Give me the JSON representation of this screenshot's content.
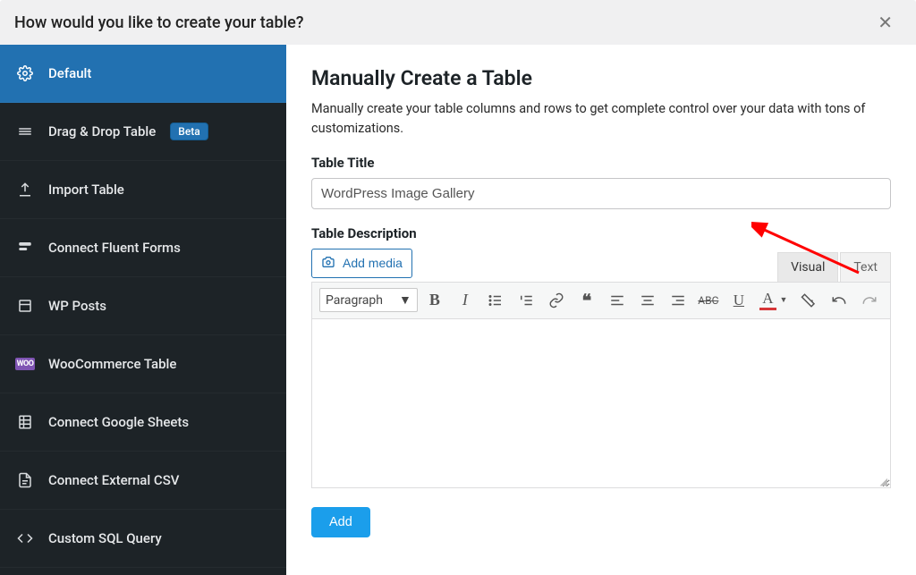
{
  "header": {
    "title": "How would you like to create your table?"
  },
  "sidebar": {
    "items": [
      {
        "label": "Default"
      },
      {
        "label": "Drag & Drop Table",
        "badge": "Beta"
      },
      {
        "label": "Import Table"
      },
      {
        "label": "Connect Fluent Forms"
      },
      {
        "label": "WP Posts"
      },
      {
        "label": "WooCommerce Table"
      },
      {
        "label": "Connect Google Sheets"
      },
      {
        "label": "Connect External CSV"
      },
      {
        "label": "Custom SQL Query"
      }
    ]
  },
  "main": {
    "heading": "Manually Create a Table",
    "subtitle": "Manually create your table columns and rows to get complete control over your data with tons of customizations.",
    "table_title_label": "Table Title",
    "table_title_value": "WordPress Image Gallery",
    "table_description_label": "Table Description",
    "add_media_label": "Add media",
    "tabs": {
      "visual": "Visual",
      "text": "Text"
    },
    "format_select": "Paragraph",
    "add_button": "Add"
  }
}
